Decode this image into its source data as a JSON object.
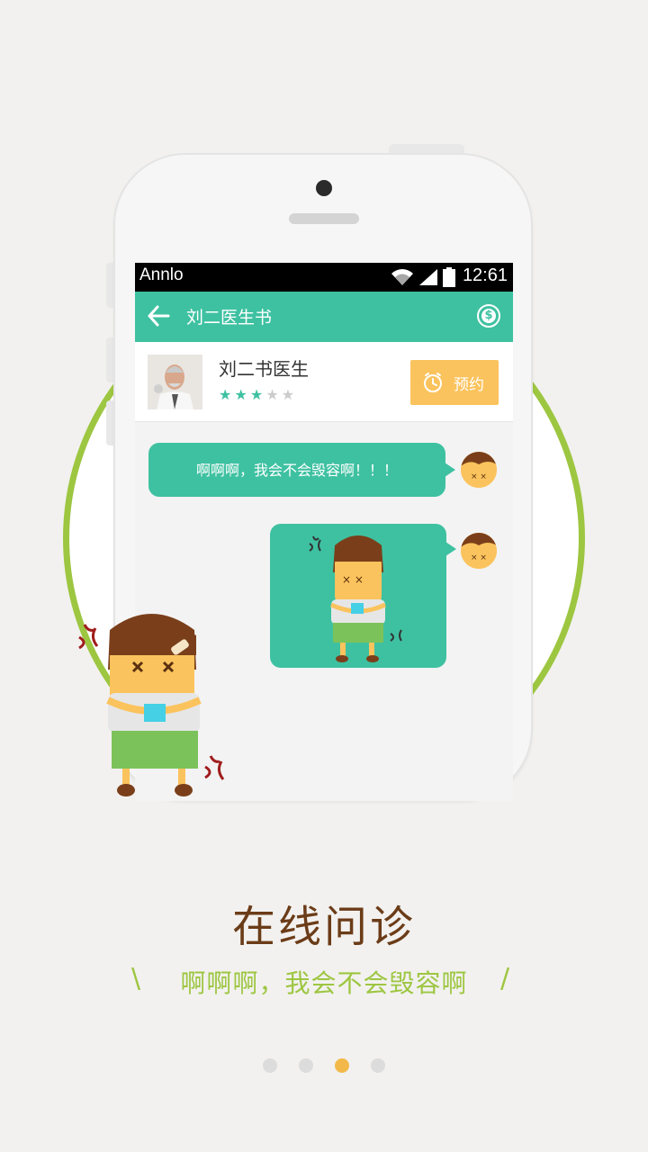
{
  "statusbar": {
    "carrier": "Annlo",
    "time": "12:61"
  },
  "toolbar": {
    "title": "刘二医生书"
  },
  "doctor": {
    "name": "刘二书医生",
    "rating": 3,
    "rating_max": 5,
    "book_label": "预约"
  },
  "chat": {
    "message1": "啊啊啊，我会不会毁容啊！！！"
  },
  "feature": {
    "title": "在线问诊",
    "subtitle": "啊啊啊，我会不会毁容啊",
    "slash_left": "\\",
    "slash_right": "/"
  },
  "pager": {
    "pages": 4,
    "active_index": 2
  },
  "colors": {
    "accent": "#3ec1a1",
    "ring": "#9dc641",
    "button": "#fbc35d",
    "title": "#6b3c18"
  }
}
